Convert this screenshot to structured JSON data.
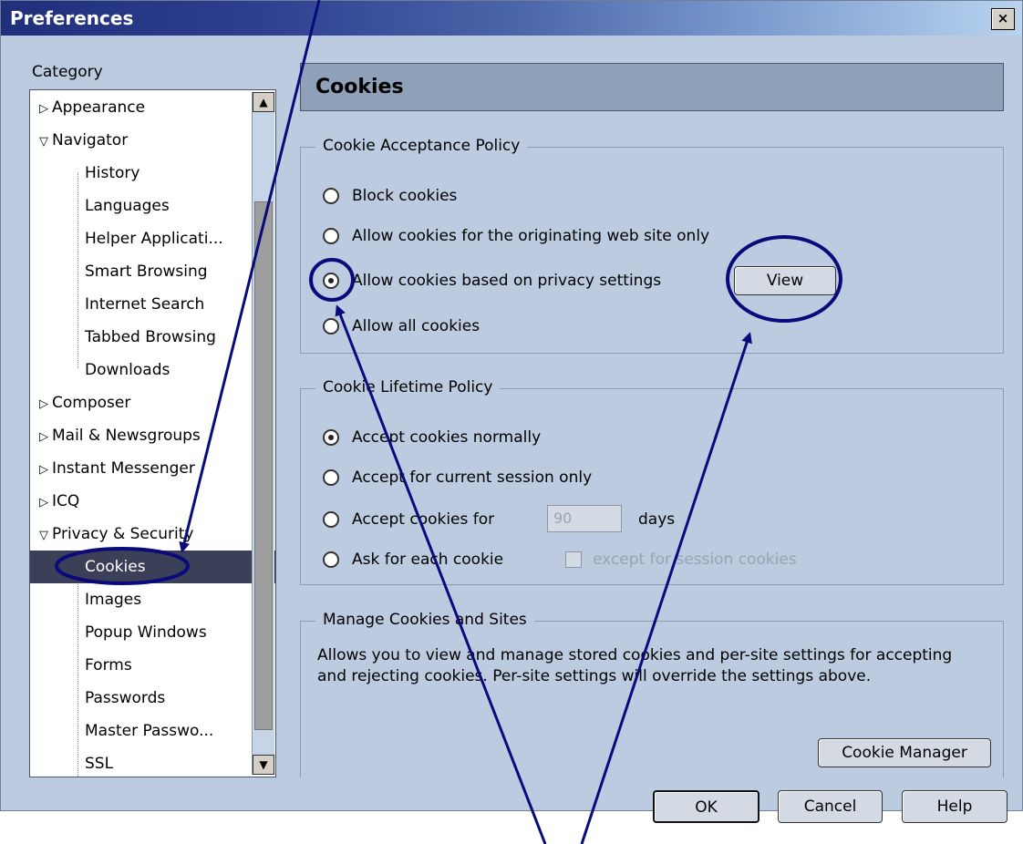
{
  "window": {
    "title": "Preferences",
    "close_glyph": "×"
  },
  "sidebar": {
    "label": "Category",
    "items": [
      {
        "label": "Appearance",
        "type": "collapsed"
      },
      {
        "label": "Navigator",
        "type": "expanded"
      },
      {
        "label": "History",
        "type": "child"
      },
      {
        "label": "Languages",
        "type": "child"
      },
      {
        "label": "Helper Applicati...",
        "type": "child"
      },
      {
        "label": "Smart Browsing",
        "type": "child"
      },
      {
        "label": "Internet Search",
        "type": "child"
      },
      {
        "label": "Tabbed Browsing",
        "type": "child"
      },
      {
        "label": "Downloads",
        "type": "child"
      },
      {
        "label": "Composer",
        "type": "collapsed"
      },
      {
        "label": "Mail & Newsgroups",
        "type": "collapsed"
      },
      {
        "label": "Instant Messenger",
        "type": "collapsed"
      },
      {
        "label": "ICQ",
        "type": "collapsed"
      },
      {
        "label": "Privacy & Security",
        "type": "expanded"
      },
      {
        "label": "Cookies",
        "type": "child",
        "selected": true
      },
      {
        "label": "Images",
        "type": "child"
      },
      {
        "label": "Popup Windows",
        "type": "child"
      },
      {
        "label": "Forms",
        "type": "child"
      },
      {
        "label": "Passwords",
        "type": "child"
      },
      {
        "label": "Master Passwo...",
        "type": "child"
      },
      {
        "label": "SSL",
        "type": "child"
      }
    ]
  },
  "panel": {
    "title": "Cookies",
    "acceptance": {
      "title": "Cookie Acceptance Policy",
      "options": [
        "Block cookies",
        "Allow cookies for the originating web site only",
        "Allow cookies based on privacy settings",
        "Allow all cookies"
      ],
      "selected_index": 2,
      "view_button": "View"
    },
    "lifetime": {
      "title": "Cookie Lifetime Policy",
      "options": [
        "Accept cookies normally",
        "Accept for current session only",
        "Accept cookies for",
        "Ask for each cookie"
      ],
      "selected_index": 0,
      "days_value": "90",
      "days_label": "days",
      "except_label": "except for session cookies"
    },
    "manage": {
      "title": "Manage Cookies and Sites",
      "description": "Allows you to view and manage stored cookies and per-site settings for accepting and rejecting cookies. Per-site settings will override the settings above.",
      "manager_button": "Cookie Manager"
    }
  },
  "footer": {
    "ok": "OK",
    "cancel": "Cancel",
    "help": "Help"
  },
  "colors": {
    "annotation": "#0a0a7a",
    "selection": "#3b3f58",
    "window_bg": "#bccbe0"
  },
  "icons": {
    "scroll_up": "▲",
    "scroll_down": "▼",
    "expanded": "▽",
    "collapsed": "▷"
  }
}
